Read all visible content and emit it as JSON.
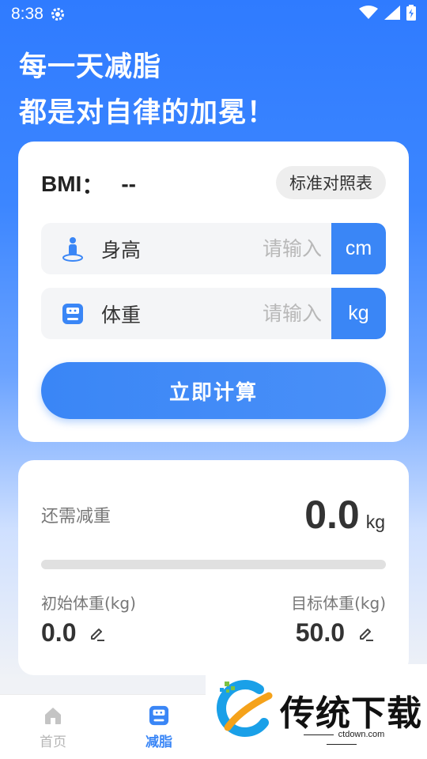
{
  "status_bar": {
    "time": "8:38"
  },
  "headline": {
    "line1": "每一天减脂",
    "line2": "都是对自律的加冕！"
  },
  "bmi_card": {
    "label": "BMI",
    "colon": "：",
    "value": "--",
    "standard_table_button": "标准对照表",
    "height": {
      "label": "身高",
      "placeholder": "请输入",
      "value": "",
      "unit": "cm"
    },
    "weight": {
      "label": "体重",
      "placeholder": "请输入",
      "value": "",
      "unit": "kg"
    },
    "calculate_button": "立即计算"
  },
  "goal_card": {
    "need_lose_label": "还需减重",
    "need_lose_value": "0.0",
    "need_lose_unit": "kg",
    "progress_fraction": 0,
    "initial_weight_label": "初始体重(kg)",
    "initial_weight_value": "0.0",
    "target_weight_label": "目标体重(kg)",
    "target_weight_value": "50.0"
  },
  "tabbar": {
    "items": [
      {
        "label": "首页",
        "icon": "home-icon",
        "active": false
      },
      {
        "label": "减脂",
        "icon": "scale-icon",
        "active": true
      }
    ]
  },
  "watermark": {
    "brand": "传统下载",
    "site": "ctdown.com"
  },
  "colors": {
    "accent": "#3a86f6",
    "header_top": "#2f7bff",
    "muted_text": "#777777"
  }
}
